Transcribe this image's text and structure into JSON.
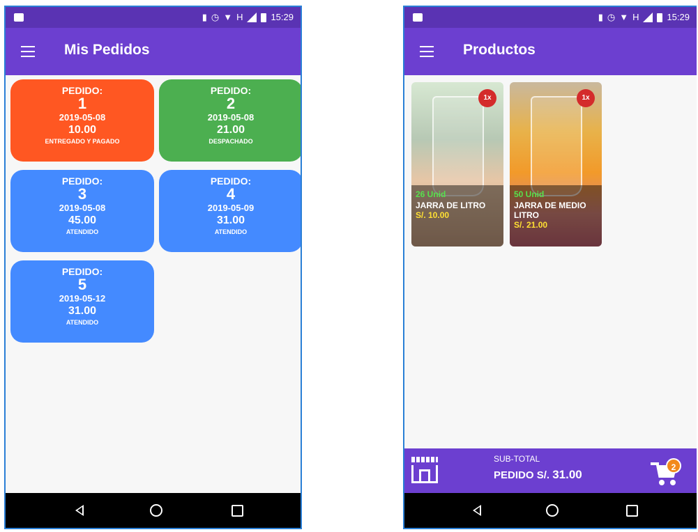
{
  "status": {
    "time": "15:29",
    "network": "H"
  },
  "orders_screen": {
    "title": "Mis Pedidos",
    "orders": [
      {
        "label": "PEDIDO:",
        "number": "1",
        "date": "2019-05-08",
        "amount": "10.00",
        "status": "ENTREGADO Y PAGADO",
        "color": "#ff5722"
      },
      {
        "label": "PEDIDO:",
        "number": "2",
        "date": "2019-05-08",
        "amount": "21.00",
        "status": "DESPACHADO",
        "color": "#4caf50"
      },
      {
        "label": "PEDIDO:",
        "number": "3",
        "date": "2019-05-08",
        "amount": "45.00",
        "status": "ATENDIDO",
        "color": "#448aff"
      },
      {
        "label": "PEDIDO:",
        "number": "4",
        "date": "2019-05-09",
        "amount": "31.00",
        "status": "ATENDIDO",
        "color": "#448aff"
      },
      {
        "label": "PEDIDO:",
        "number": "5",
        "date": "2019-05-12",
        "amount": "31.00",
        "status": "ATENDIDO",
        "color": "#448aff"
      }
    ]
  },
  "products_screen": {
    "title": "Productos",
    "products": [
      {
        "stock": "26 Unid",
        "name": "JARRA DE LITRO",
        "price": "S/. 10.00",
        "qty": "1x"
      },
      {
        "stock": "50 Unid",
        "name": "JARRA DE MEDIO LITRO",
        "price": "S/. 21.00",
        "qty": "1x"
      }
    ],
    "subtotal_label": "SUB-TOTAL",
    "subtotal_prefix": "PEDIDO",
    "subtotal_currency": "S/.",
    "subtotal_value": "31.00",
    "cart_count": "2"
  },
  "colors": {
    "appbar": "#6c3fd0",
    "statusbar": "#5a33b3",
    "accent_badge": "#f28a1c"
  },
  "icons": [
    "menu-icon",
    "store-icon",
    "cart-icon",
    "back-icon",
    "home-icon",
    "recents-icon"
  ]
}
